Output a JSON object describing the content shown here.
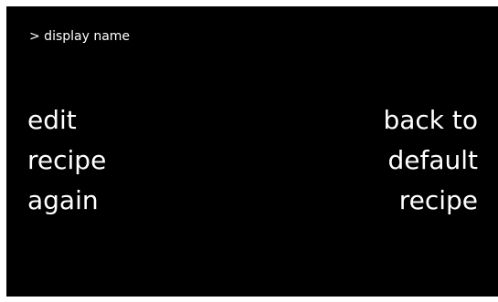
{
  "header": {
    "breadcrumb": "> display name"
  },
  "actions": {
    "edit_again": {
      "lines": [
        "edit",
        "recipe",
        "again"
      ]
    },
    "back_to_default": {
      "lines": [
        "back to",
        "default",
        "recipe"
      ]
    }
  },
  "colors": {
    "background": "#000000",
    "text": "#ffffff",
    "frame": "#ffffff"
  }
}
